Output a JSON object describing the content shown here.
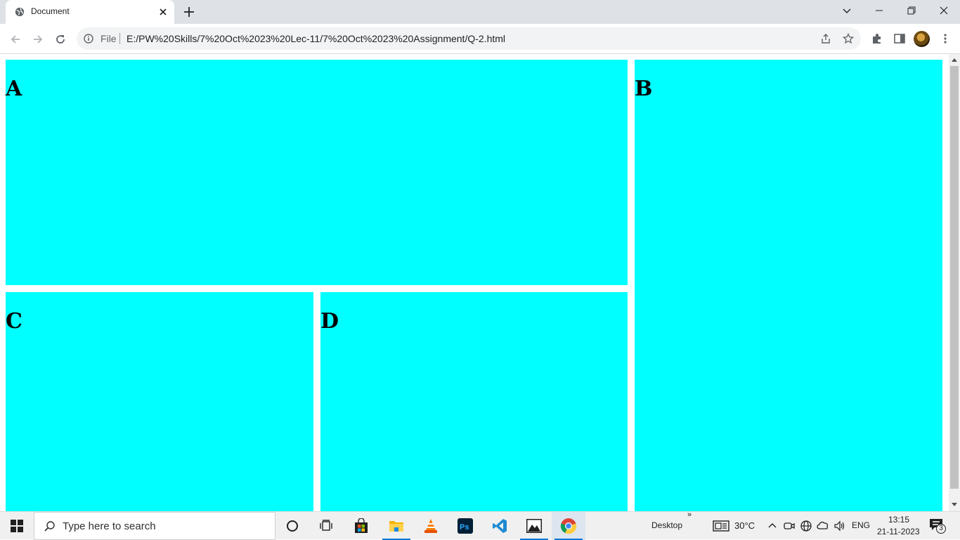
{
  "browser": {
    "tab_title": "Document",
    "address_scheme": "File",
    "address_url": "E:/PW%20Skills/7%20Oct%2023%20Lec-11/7%20Oct%2023%20Assignment/Q-2.html"
  },
  "page": {
    "box_a": "A",
    "box_b": "B",
    "box_c": "C",
    "box_d": "D",
    "box_color": "#00ffff"
  },
  "taskbar": {
    "search_placeholder": "Type here to search",
    "desktop_label": "Desktop",
    "more_chevron": "»",
    "temperature": "30°C",
    "language": "ENG",
    "time": "13:15",
    "date": "21-11-2023",
    "notification_count": "3"
  },
  "icons": [
    "globe-icon",
    "close-icon",
    "plus-icon",
    "chevron-down-icon",
    "minimize-icon",
    "restore-icon",
    "back-arrow-icon",
    "forward-arrow-icon",
    "reload-icon",
    "info-icon",
    "share-icon",
    "star-icon",
    "puzzle-icon",
    "side-panel-icon",
    "kebab-menu-icon",
    "windows-logo-icon",
    "cortana-icon",
    "task-view-icon",
    "store-icon",
    "file-explorer-icon",
    "vlc-icon",
    "photoshop-icon",
    "vscode-icon",
    "photos-icon",
    "chrome-icon",
    "weather-icon",
    "caret-up-icon",
    "meet-now-icon",
    "network-icon",
    "onedrive-icon",
    "volume-icon",
    "notification-icon"
  ]
}
